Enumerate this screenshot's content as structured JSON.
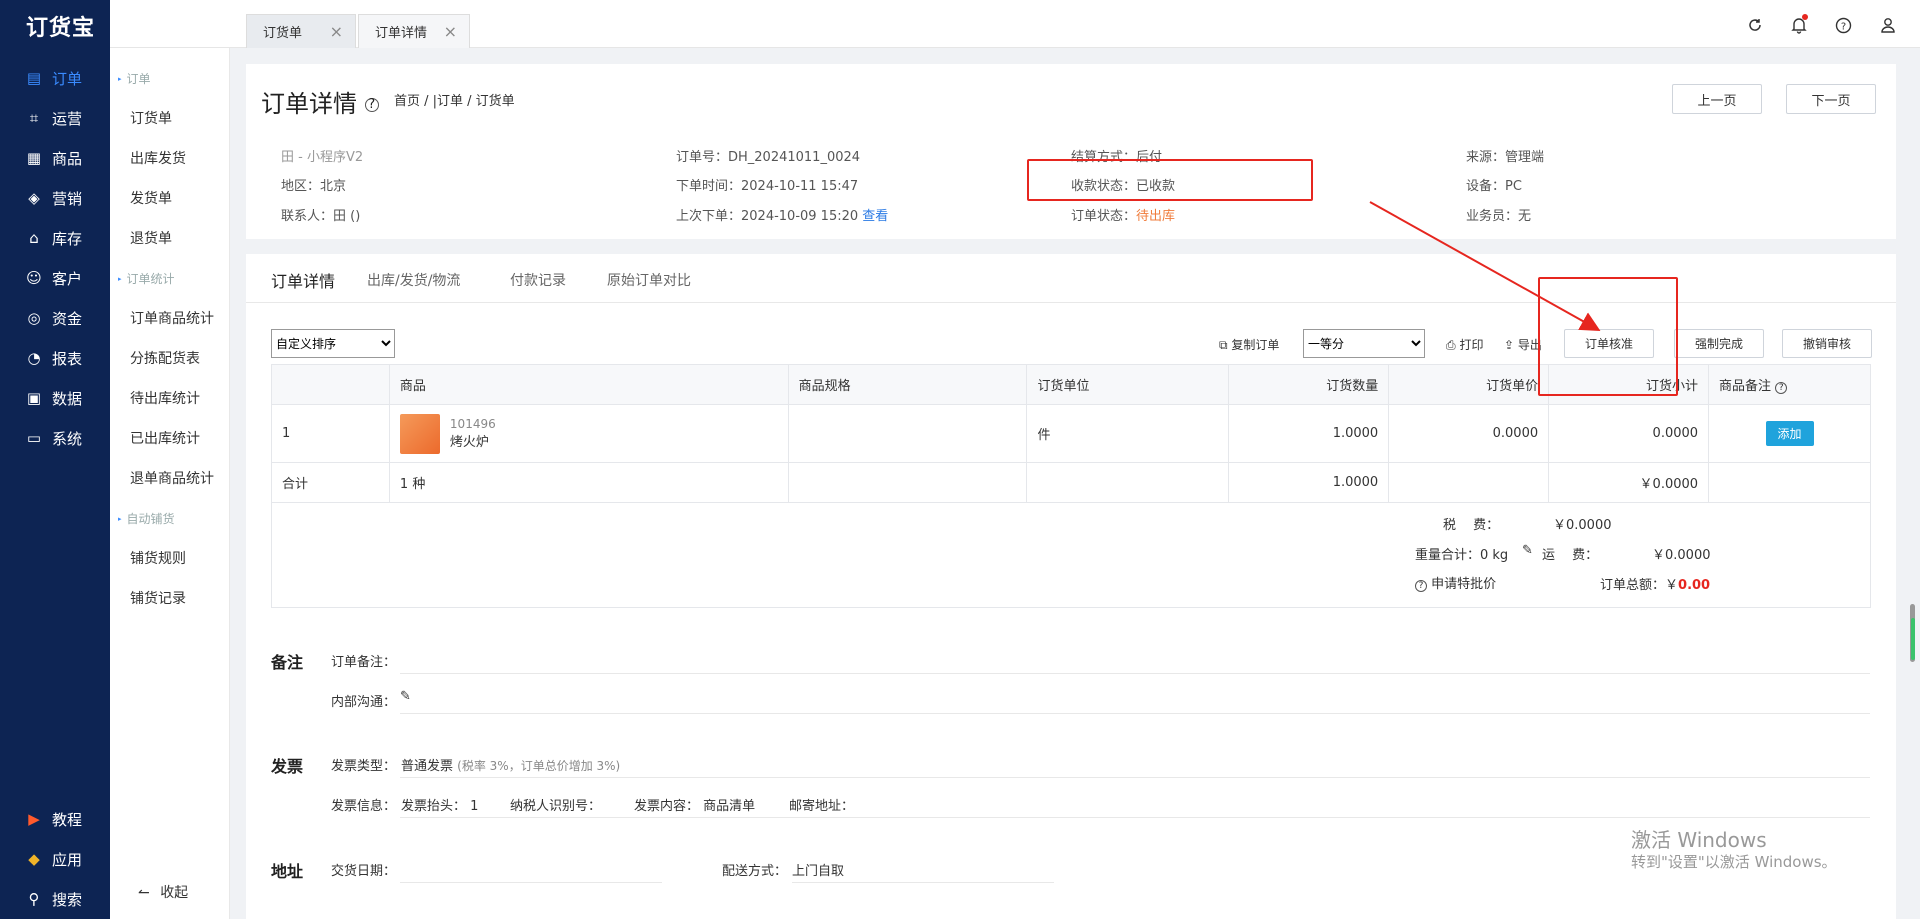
{
  "app": {
    "logo": "订货宝"
  },
  "nav": {
    "items": [
      {
        "label": "订单",
        "icon": "order-icon"
      },
      {
        "label": "运营",
        "icon": "operate-icon"
      },
      {
        "label": "商品",
        "icon": "goods-icon"
      },
      {
        "label": "营销",
        "icon": "marketing-icon"
      },
      {
        "label": "库存",
        "icon": "stock-icon"
      },
      {
        "label": "客户",
        "icon": "customer-icon"
      },
      {
        "label": "资金",
        "icon": "money-icon"
      },
      {
        "label": "报表",
        "icon": "report-icon"
      },
      {
        "label": "数据",
        "icon": "data-icon"
      },
      {
        "label": "系统",
        "icon": "system-icon"
      }
    ],
    "bottom": [
      {
        "label": "教程",
        "icon": "tutorial-icon"
      },
      {
        "label": "应用",
        "icon": "apps-icon"
      },
      {
        "label": "搜索",
        "icon": "search-icon"
      }
    ],
    "active_color": "#3a8bff"
  },
  "subnav": {
    "group1": "订单",
    "items1": [
      "订货单",
      "出库发货",
      "发货单",
      "退货单"
    ],
    "group2": "订单统计",
    "items2": [
      "订单商品统计",
      "分拣配货表",
      "待出库统计",
      "已出库统计",
      "退单商品统计"
    ],
    "group3": "自动铺货",
    "items3": [
      "铺货规则",
      "铺货记录"
    ],
    "collapse": "收起"
  },
  "tabs": [
    {
      "label": "订货单"
    },
    {
      "label": "订单详情"
    }
  ],
  "page": {
    "title": "订单详情",
    "breadcrumb": "首页 / |订单 / 订货单",
    "prev": "上一页",
    "next": "下一页"
  },
  "info": {
    "customer": "田 - 小程序V2",
    "region": "地区：北京",
    "contact": "联系人：田  ()",
    "order_no": "订单号：DH_20241011_0024",
    "order_time": "下单时间：2024-10-11 15:47",
    "last_order": "上次下单：2024-10-09 15:20",
    "view": "查看",
    "settle": "结算方式：后付",
    "pay_status": "收款状态：已收款",
    "order_status_label": "订单状态：",
    "order_status": "待出库",
    "source": "来源：管理端",
    "device": "设备：PC",
    "salesman": "业务员：无",
    "status_color": "#f07c3c"
  },
  "detail_tabs": [
    "订单详情",
    "出库/发货/物流",
    "付款记录",
    "原始订单对比"
  ],
  "toolbar": {
    "sort": "自定义排序",
    "copy": "复制订单",
    "level": "一等分",
    "print": "打印",
    "export": "导出",
    "verify": "订单核准",
    "force": "强制完成",
    "revoke": "撤销审核"
  },
  "table": {
    "headers": [
      "",
      "商品",
      "商品规格",
      "订货单位",
      "订货数量",
      "订货单价",
      "订货小计",
      "商品备注"
    ],
    "row": {
      "idx": "1",
      "code": "101496",
      "name": "烤火炉",
      "spec": "",
      "unit": "件",
      "qty": "1.0000",
      "price": "0.0000",
      "subtotal": "0.0000",
      "action": "添加"
    },
    "total": {
      "label": "合计",
      "kinds": "1 种",
      "qty": "1.0000",
      "subtotal": "￥0.0000"
    }
  },
  "summary": {
    "tax_label": "税　 费：",
    "tax": "￥0.0000",
    "weight": "重量合计：0 kg",
    "freight_label": "运　 费：",
    "freight": "￥0.0000",
    "special": "申请特批价",
    "total_label": "订单总额：",
    "total_cur": "￥",
    "total": "0.00"
  },
  "remark": {
    "section": "备注",
    "order_note": "订单备注：",
    "internal": "内部沟通："
  },
  "invoice": {
    "section": "发票",
    "type_label": "发票类型：",
    "type": "普通发票",
    "type_note": "(税率 3%，订单总价增加 3%)",
    "info_label": "发票信息：",
    "title": "发票抬头：  1",
    "taxid": "纳税人识别号：",
    "content": "发票内容：  商品清单",
    "mail": "邮寄地址："
  },
  "address": {
    "section": "地址",
    "date_label": "交货日期：",
    "ship_label": "配送方式：",
    "ship": "上门自取"
  },
  "watermark": {
    "line1": "激活 Windows",
    "line2": "转到\"设置\"以激活 Windows。"
  }
}
